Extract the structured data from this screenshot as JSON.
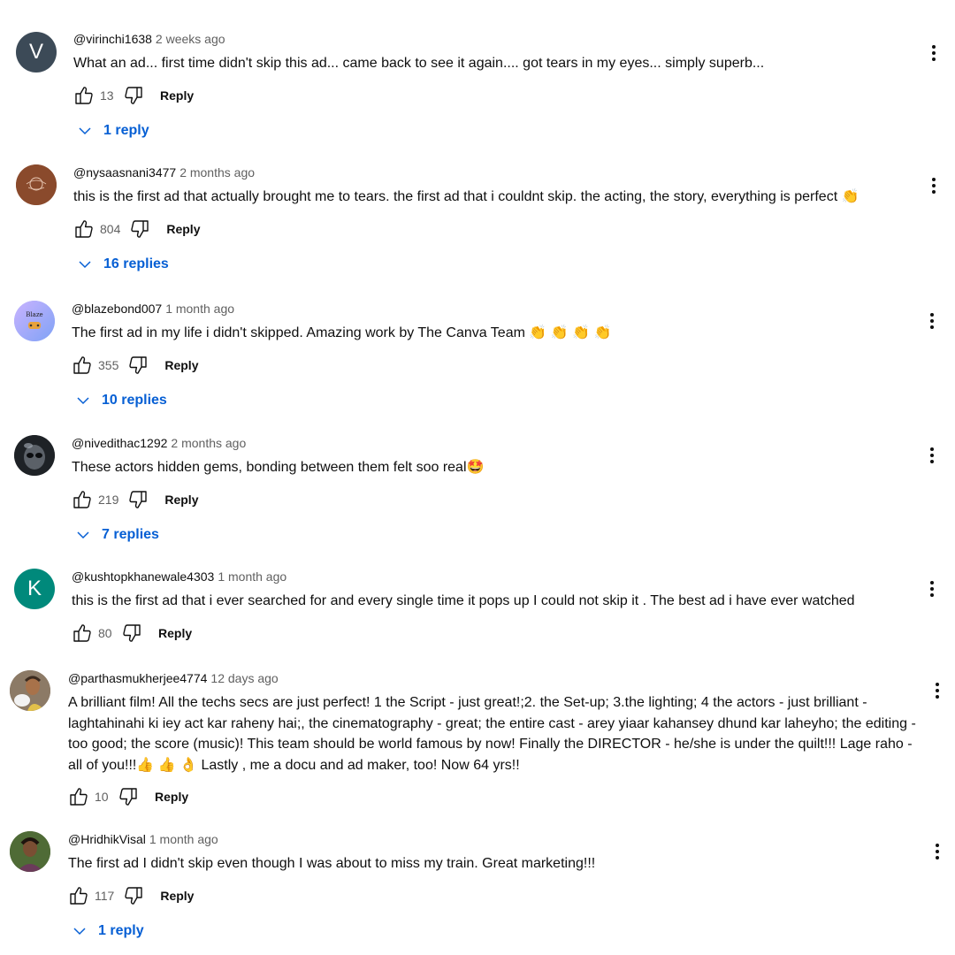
{
  "comments": [
    {
      "handle": "@virinchi1638",
      "time": "2 weeks ago",
      "text": "What an ad... first time didn't skip this ad... came back to see it again.... got tears in my eyes... simply superb...",
      "likes": "13",
      "reply_label": "Reply",
      "replies": "1 reply",
      "avatar_letter": "V",
      "avatar_color": "#3c4a57"
    },
    {
      "handle": "@nysaasnani3477",
      "time": "2 months ago",
      "text": "this is the first ad that actually brought me to tears. the first ad that i couldnt skip. the acting, the story, everything is perfect 👏",
      "likes": "804",
      "reply_label": "Reply",
      "replies": "16 replies",
      "avatar_color": "#8a4a2c"
    },
    {
      "handle": "@blazebond007",
      "time": "1 month ago",
      "text": "The first ad in my life i didn't skipped. Amazing work by The Canva Team 👏 👏 👏 👏",
      "likes": "355",
      "reply_label": "Reply",
      "replies": "10 replies",
      "avatar_label": "Blaze",
      "avatar_color": "#9aa6f7"
    },
    {
      "handle": "@nivedithac1292",
      "time": "2 months ago",
      "text": "These actors hidden gems, bonding between them felt soo real🤩",
      "likes": "219",
      "reply_label": "Reply",
      "replies": "7 replies",
      "avatar_color": "#1e2226"
    },
    {
      "handle": "@kushtopkhanewale4303",
      "time": "1 month ago",
      "text": "this is the first ad that i ever searched for and every single time it pops up I could not skip it . The best ad i have ever watched",
      "likes": "80",
      "reply_label": "Reply",
      "avatar_letter": "K",
      "avatar_color": "#00897b"
    },
    {
      "handle": "@parthasmukherjee4774",
      "time": "12 days ago",
      "text": "A brilliant film! All the techs secs are just perfect! 1 the Script - just great!;2. the Set-up; 3.the lighting; 4 the actors - just brilliant - laghtahinahi ki iey act kar raheny hai;, the cinematography - great; the entire cast - arey yiaar kahansey dhund kar laheyho; the editing - too good; the score (music)! This team should be world famous by now! Finally the DIRECTOR - he/she is under the quilt!!! Lage raho - all of you!!!👍 👍 👌  Lastly , me a docu and ad maker, too! Now 64 yrs!!",
      "likes": "10",
      "reply_label": "Reply",
      "avatar_color": "#8c7a66"
    },
    {
      "handle": "@HridhikVisal",
      "time": "1 month ago",
      "text": "The first ad I didn't skip even though I was about to miss my train. Great marketing!!!",
      "likes": "117",
      "reply_label": "Reply",
      "replies": "1 reply",
      "avatar_color": "#5a6b3a"
    }
  ],
  "colors": {
    "link": "#065fd4",
    "secondary_text": "#606060",
    "primary_text": "#0f0f0f"
  },
  "icons": [
    "thumbs-up-icon",
    "thumbs-down-icon",
    "chevron-down-icon",
    "more-vert-icon"
  ]
}
